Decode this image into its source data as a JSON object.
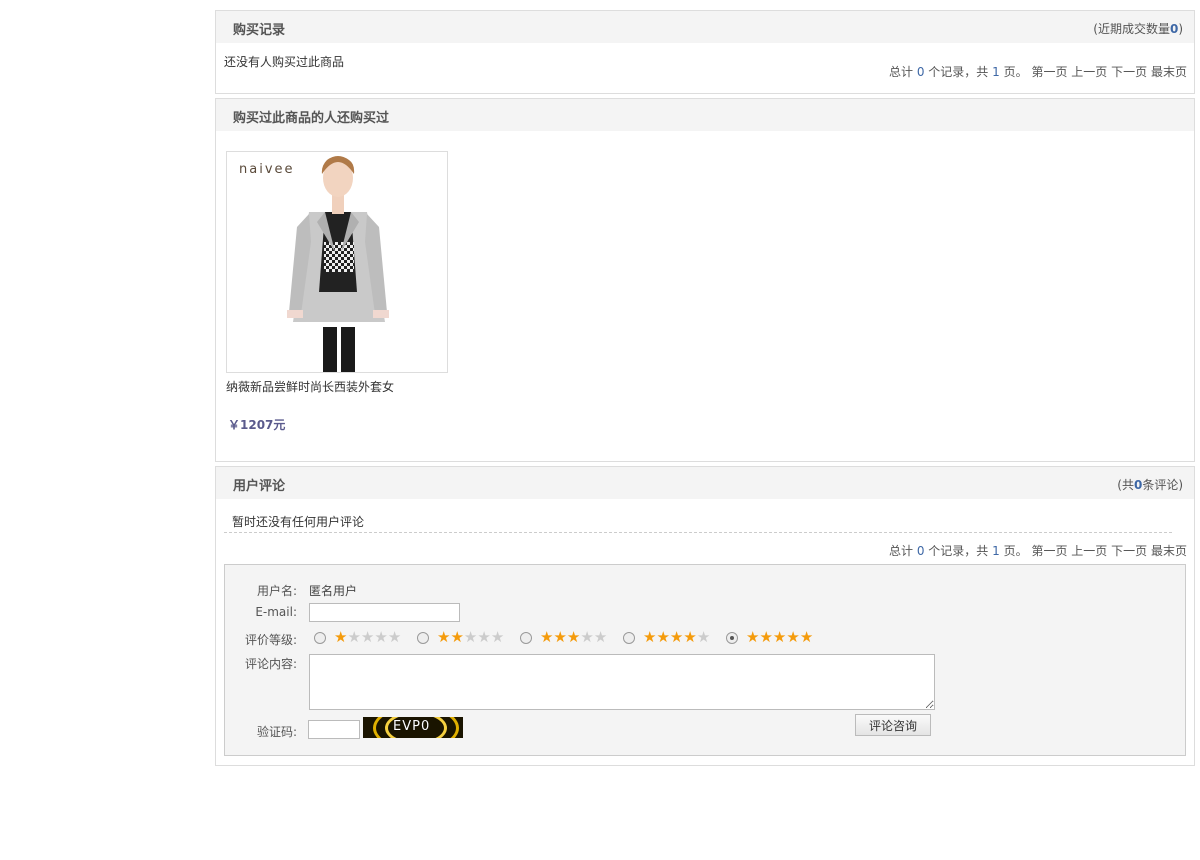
{
  "purchase_records": {
    "title": "购买记录",
    "extra_prefix": "(近期成交数量",
    "extra_count": "0",
    "extra_suffix": ")",
    "empty_text": "还没有人购买过此商品"
  },
  "pager": {
    "prefix": "总计",
    "records": "0",
    "records_unit": "个记录，共",
    "pages": "1",
    "pages_unit": "页。",
    "first": "第一页",
    "prev": "上一页",
    "next": "下一页",
    "last": "最末页"
  },
  "also_bought": {
    "title": "购买过此商品的人还购买过",
    "product": {
      "brand_mark": "naivee",
      "name": "纳薇新品尝鲜时尚长西装外套女",
      "price": "￥1207元"
    }
  },
  "reviews": {
    "title": "用户评论",
    "extra_prefix": "(共",
    "extra_count": "0",
    "extra_suffix": "条评论)",
    "empty_text": "暂时还没有任何用户评论"
  },
  "comment_form": {
    "username_label": "用户名:",
    "username_value": "匿名用户",
    "email_label": "E-mail:",
    "rating_label": "评价等级:",
    "ratings": [
      1,
      2,
      3,
      4,
      5
    ],
    "selected_rating": 5,
    "content_label": "评论内容:",
    "captcha_label": "验证码:",
    "captcha_text": "EVP0",
    "submit_label": "评论咨询"
  },
  "colors": {
    "accent_number": "#3e68a6",
    "price": "#5a5a8c",
    "star_on": "#f49b0c",
    "star_off": "#cccccc",
    "header_bg": "#f4f4f4"
  }
}
